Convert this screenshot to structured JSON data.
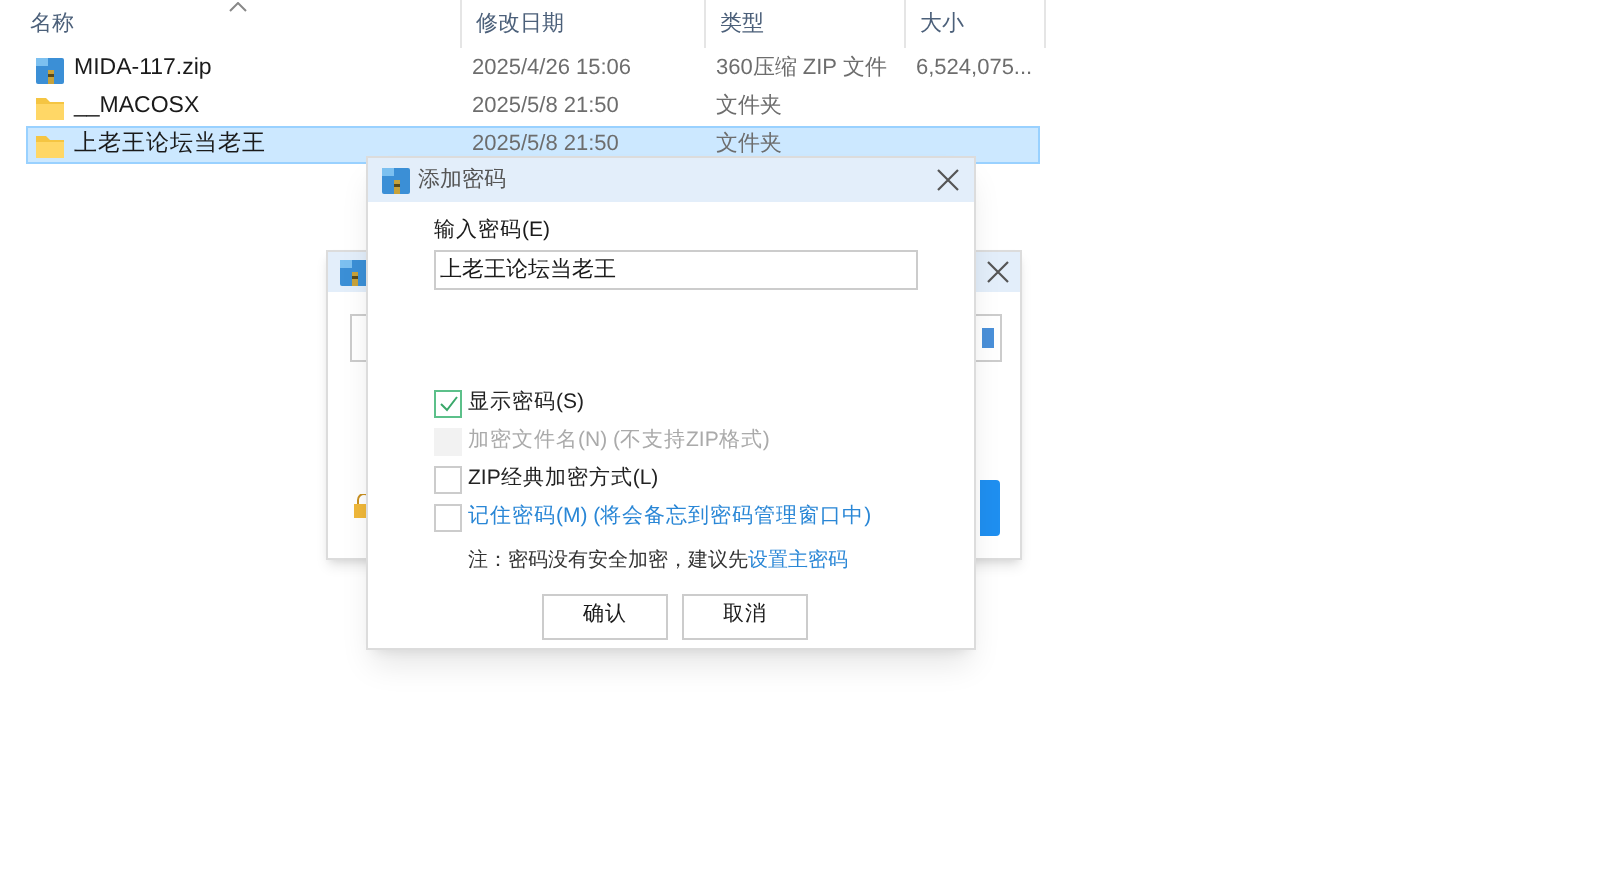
{
  "explorer": {
    "columns": [
      {
        "label": "名称",
        "sorted": true
      },
      {
        "label": "修改日期",
        "sorted": false
      },
      {
        "label": "类型",
        "sorted": false
      },
      {
        "label": "大小",
        "sorted": false
      }
    ],
    "rows": [
      {
        "kind": "zip",
        "name": "MIDA-117.zip",
        "date": "2025/4/26 15:06",
        "type": "360压缩 ZIP 文件",
        "size": "6,524,075...",
        "selected": false
      },
      {
        "kind": "folder",
        "name": "__MACOSX",
        "date": "2025/5/8 21:50",
        "type": "文件夹",
        "selected": false
      },
      {
        "kind": "folder",
        "name": "上老王论坛当老王",
        "date": "2025/5/8 21:50",
        "type": "文件夹",
        "selected": true
      }
    ]
  },
  "dialog": {
    "title": "添加密码",
    "password_label": "输入密码(E)",
    "password_value": "上老王论坛当老王",
    "options": [
      {
        "label": "显示密码(S)",
        "checked": true,
        "disabled": false,
        "link": false
      },
      {
        "label": "加密文件名(N) (不支持ZIP格式)",
        "checked": false,
        "disabled": true,
        "link": false
      },
      {
        "label": "ZIP经典加密方式(L)",
        "checked": false,
        "disabled": false,
        "link": false
      },
      {
        "label": "记住密码(M) (将会备忘到密码管理窗口中)",
        "checked": false,
        "disabled": false,
        "link": true
      }
    ],
    "note": "注：密码没有安全加密，建议先",
    "note_link": "设置主密码",
    "buttons": [
      "确认",
      "取消"
    ]
  }
}
